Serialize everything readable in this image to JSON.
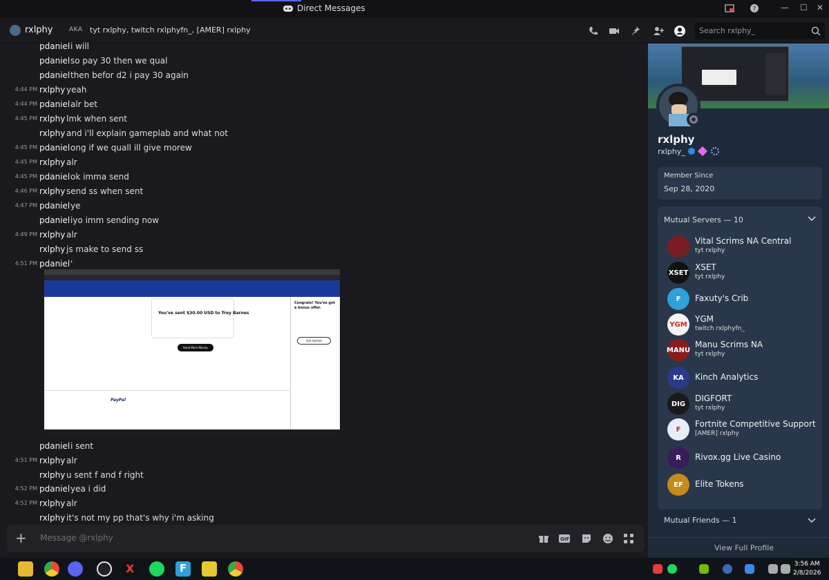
{
  "window": {
    "title": "Direct Messages"
  },
  "header": {
    "username": "rxlphy",
    "aka_label": "AKA",
    "aka_text": "tyt rxlphy, twitch rxlphyfn_, [AMER] rxlphy",
    "search_placeholder": "Search rxlphy_"
  },
  "messages": [
    {
      "time": "",
      "author": "pdaniel",
      "text": "i will"
    },
    {
      "time": "",
      "author": "pdaniel",
      "text": "so pay 30 then we qual"
    },
    {
      "time": "",
      "author": "pdaniel",
      "text": "then befor d2 i pay 30 again"
    },
    {
      "time": "4:44 PM",
      "author": "rxlphy",
      "text": "yeah"
    },
    {
      "time": "4:44 PM",
      "author": "pdaniel",
      "text": "alr bet"
    },
    {
      "time": "4:45 PM",
      "author": "rxlphy",
      "text": "lmk when sent"
    },
    {
      "time": "",
      "author": "rxlphy",
      "text": "and i'll explain gameplab and what not"
    },
    {
      "time": "4:45 PM",
      "author": "pdaniel",
      "text": "ong if we quall ill give morew"
    },
    {
      "time": "4:45 PM",
      "author": "rxlphy",
      "text": "alr"
    },
    {
      "time": "4:45 PM",
      "author": "pdaniel",
      "text": "ok imma send"
    },
    {
      "time": "4:46 PM",
      "author": "rxlphy",
      "text": "send ss when sent"
    },
    {
      "time": "4:47 PM",
      "author": "pdaniel",
      "text": "ye"
    },
    {
      "time": "",
      "author": "pdaniel",
      "text": "iyo imm sending now"
    },
    {
      "time": "4:49 PM",
      "author": "rxlphy",
      "text": "alr"
    },
    {
      "time": "",
      "author": "rxlphy",
      "text": "js make to send ss"
    },
    {
      "time": "4:51 PM",
      "author": "pdaniel",
      "text": "'"
    }
  ],
  "screenshot": {
    "sent_text": "You've sent $30.00 USD to Trey Barnes",
    "send_more": "Send More Money",
    "bonus_title": "Congrats! You've got a bonus offer.",
    "get_started": "Get started",
    "paypal": "PayPal"
  },
  "messages_after": [
    {
      "time": "",
      "author": "pdaniel",
      "text": "i sent"
    },
    {
      "time": "4:51 PM",
      "author": "rxlphy",
      "text": "alr"
    },
    {
      "time": "",
      "author": "rxlphy",
      "text": "u sent f and f right"
    },
    {
      "time": "4:52 PM",
      "author": "pdaniel",
      "text": "yea i did"
    },
    {
      "time": "4:52 PM",
      "author": "rxlphy",
      "text": "alr"
    },
    {
      "time": "",
      "author": "rxlphy",
      "text": "it's not my pp that's why i'm asking"
    }
  ],
  "composer": {
    "placeholder": "Message @rxlphy"
  },
  "profile": {
    "name": "rxlphy",
    "handle": "rxlphy_",
    "member_since_label": "Member Since",
    "member_since": "Sep 28, 2020",
    "mutual_servers_label": "Mutual Servers — 10",
    "mutual_friends_label": "Mutual Friends — 1",
    "view_full": "View Full Profile",
    "servers": [
      {
        "name": "Vital Scrims NA Central",
        "sub": "tyt rxlphy",
        "color": "#7a1c24",
        "abbr": ""
      },
      {
        "name": "XSET",
        "sub": "tyt rxlphy",
        "color": "#111111",
        "abbr": "XSET"
      },
      {
        "name": "Faxuty's Crib",
        "sub": "",
        "color": "#2fa0d8",
        "abbr": "F"
      },
      {
        "name": "YGM",
        "sub": "twitch rxlphyfn_",
        "color": "#f4f4f4",
        "abbr": "YGM"
      },
      {
        "name": "Manu Scrims NA",
        "sub": "tyt rxlphy",
        "color": "#8a1c1c",
        "abbr": "MANU"
      },
      {
        "name": "Kinch Analytics",
        "sub": "",
        "color": "#2a3a8a",
        "abbr": "KA"
      },
      {
        "name": "DIGFORT",
        "sub": "tyt rxlphy",
        "color": "#1a1a1a",
        "abbr": "DIG"
      },
      {
        "name": "Fortnite Competitive Support",
        "sub": "[AMER] rxlphy",
        "color": "#e8eef8",
        "abbr": "F"
      },
      {
        "name": "Rivox.gg Live Casino",
        "sub": "",
        "color": "#3a1c5a",
        "abbr": "R"
      },
      {
        "name": "Elite Tokens",
        "sub": "",
        "color": "#c48a1c",
        "abbr": "EF"
      }
    ]
  },
  "clock": {
    "time": "3:56 AM",
    "date": "2/8/2026"
  }
}
